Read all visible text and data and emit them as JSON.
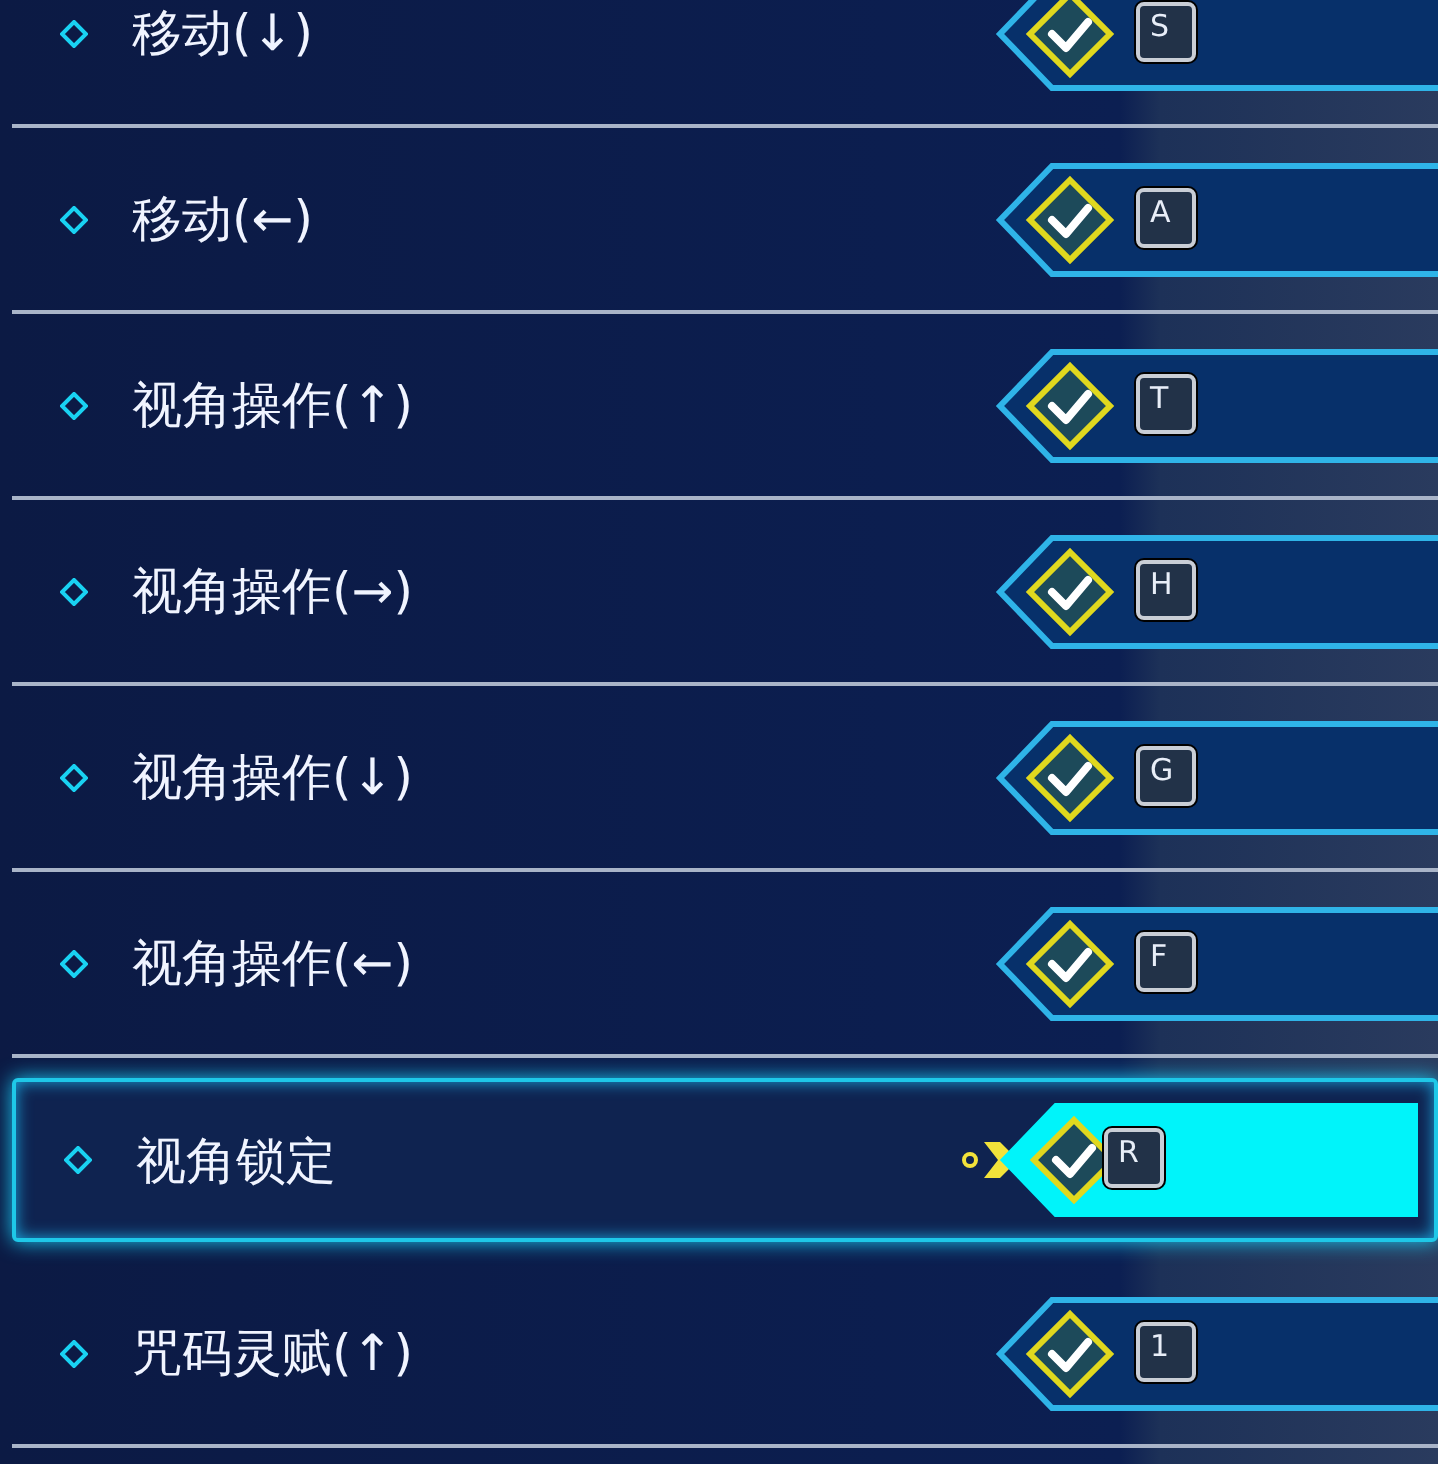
{
  "bindings": [
    {
      "label": "移动(↓)",
      "key": "S",
      "selected": false
    },
    {
      "label": "移动(←)",
      "key": "A",
      "selected": false
    },
    {
      "label": "视角操作(↑)",
      "key": "T",
      "selected": false
    },
    {
      "label": "视角操作(→)",
      "key": "H",
      "selected": false
    },
    {
      "label": "视角操作(↓)",
      "key": "G",
      "selected": false
    },
    {
      "label": "视角操作(←)",
      "key": "F",
      "selected": false
    },
    {
      "label": "视角锁定",
      "key": "R",
      "selected": true
    },
    {
      "label": "咒码灵赋(↑)",
      "key": "1",
      "selected": false
    }
  ]
}
